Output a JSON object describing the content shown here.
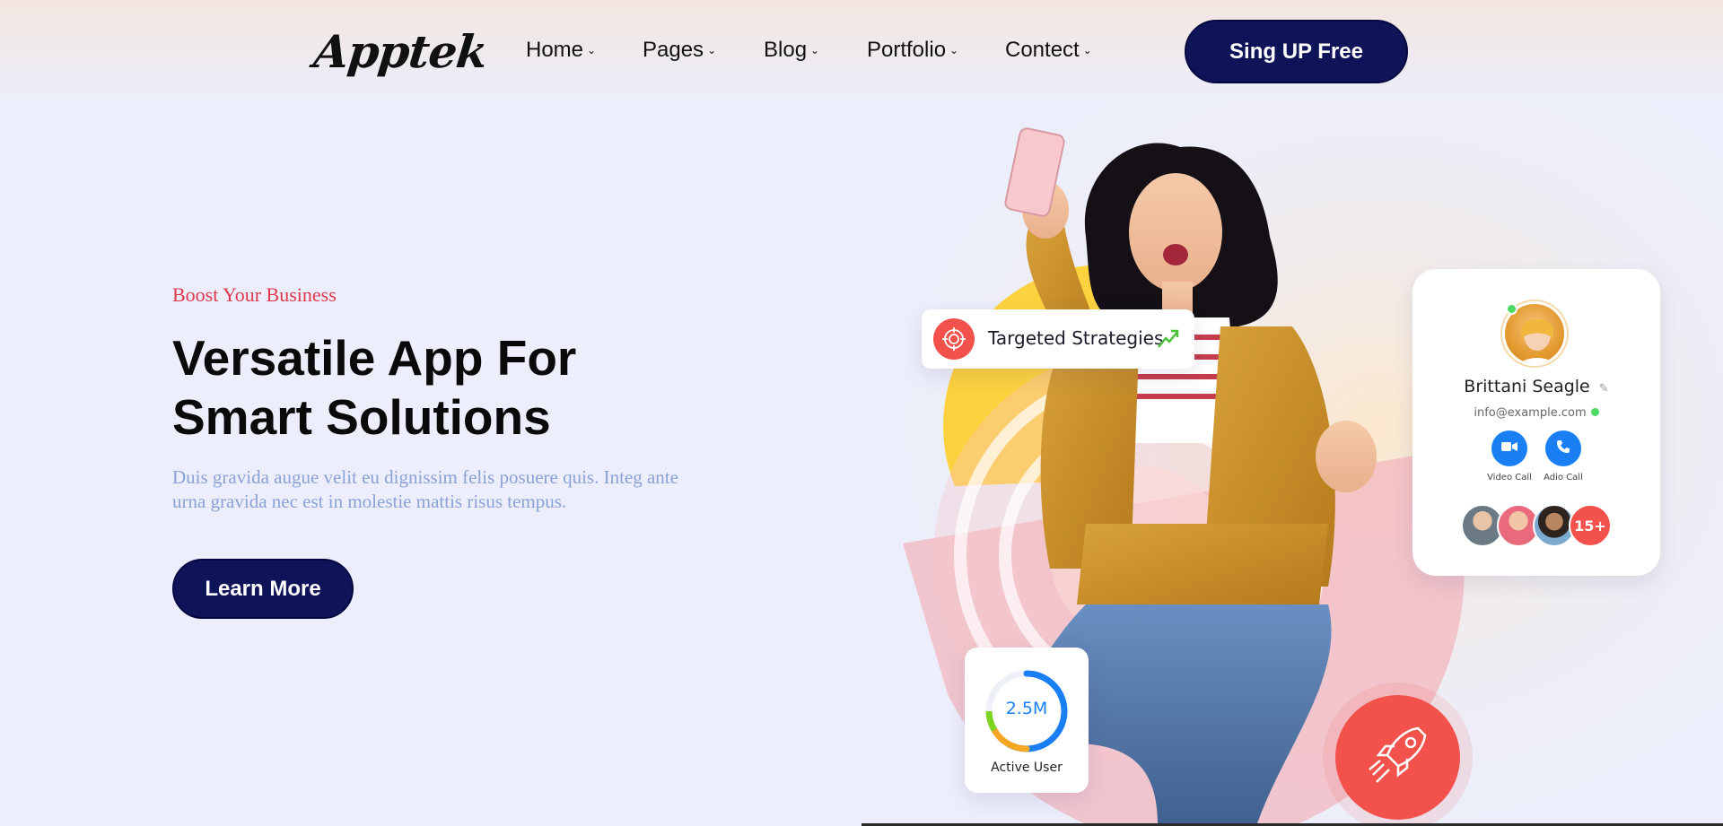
{
  "brand": {
    "logo_text": "Apptek"
  },
  "nav": {
    "items": [
      {
        "label": "Home"
      },
      {
        "label": "Pages"
      },
      {
        "label": "Blog"
      },
      {
        "label": "Portfolio"
      },
      {
        "label": "Contect"
      }
    ],
    "cta_label": "Sing UP Free"
  },
  "hero": {
    "eyebrow": "Boost Your Business",
    "headline_line1": "Versatile App For",
    "headline_line2": "Smart Solutions",
    "description": "Duis gravida augue velit eu dignissim felis posuere quis. Integ ante urna gravida nec est in molestie mattis risus tempus.",
    "button_label": "Learn More"
  },
  "strategy_card": {
    "label": "Targeted Strategies",
    "icon": "target-icon",
    "trend_icon": "trend-up-icon"
  },
  "profile_card": {
    "name": "Brittani Seagle",
    "email": "info@example.com",
    "video_label": "Video Call",
    "audio_label": "Adio Call",
    "more_count": "15+"
  },
  "stat_card": {
    "value": "2.5M",
    "label": "Active User",
    "progress": 0.8
  },
  "colors": {
    "primary_navy": "#0f1459",
    "accent_red": "#f2524b",
    "eyebrow_red": "#e0384b",
    "call_blue": "#1a7ef5",
    "background": "#eceefb"
  }
}
